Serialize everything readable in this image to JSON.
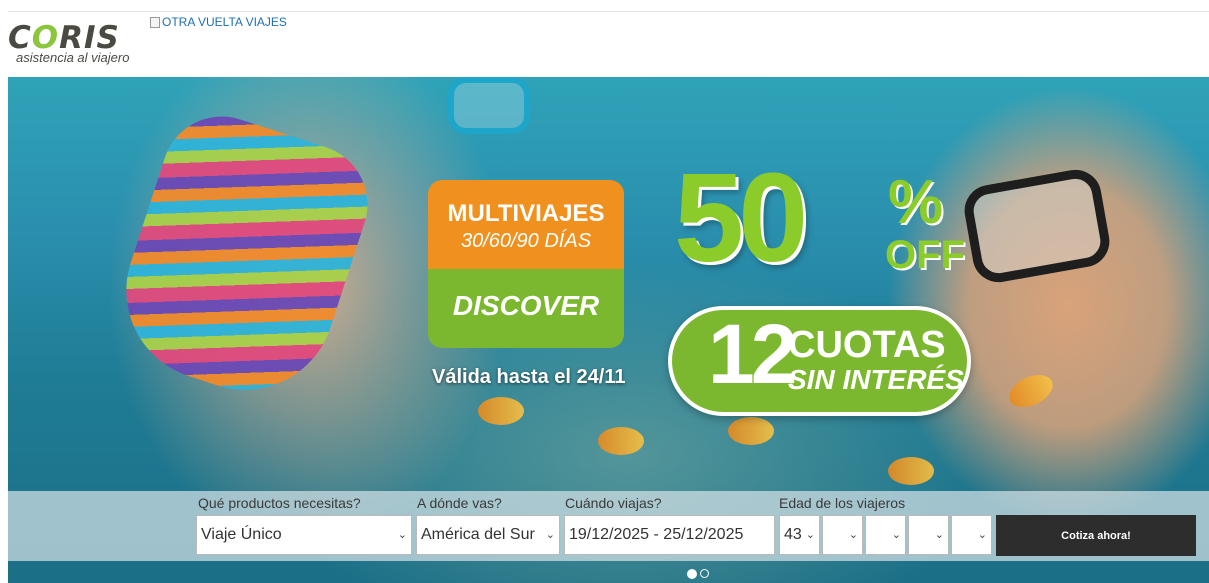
{
  "header": {
    "logo_word": "CORIS",
    "logo_tagline": "asistencia al viajero",
    "partner_alt": "OTRA VUELTA VIAJES"
  },
  "banner": {
    "promo_title": "MULTIVIAJES",
    "promo_days": "30/60/90 DÍAS",
    "promo_plan": "DISCOVER",
    "validity": "Válida hasta el 24/11",
    "discount_number": "50",
    "discount_percent": "%",
    "discount_off": "OFF",
    "installments_number": "12",
    "installments_label": "CUOTAS",
    "installments_sub": "SIN INTERÉS"
  },
  "search": {
    "products_label": "Qué productos necesitas?",
    "products_value": "Viaje Único",
    "destination_label": "A dónde vas?",
    "destination_value": "América del Sur",
    "dates_label": "Cuándo viajas?",
    "dates_value": "19/12/2025 - 25/12/2025",
    "ages_label": "Edad de los viajeros",
    "age_values": [
      "43",
      "",
      "",
      "",
      ""
    ],
    "submit_label": "Cotiza ahora!"
  },
  "carousel": {
    "slides": 2,
    "active": 1
  },
  "colors": {
    "brand_green": "#8ccc2a",
    "promo_orange": "#f0901e",
    "cta_dark": "#2d2d2d",
    "link_blue": "#1f6fb2"
  }
}
